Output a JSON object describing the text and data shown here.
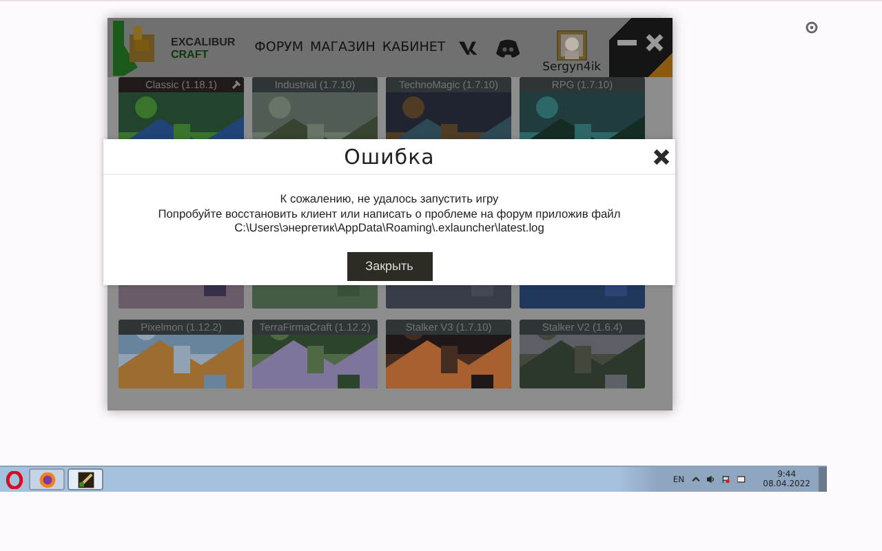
{
  "launcher": {
    "logo": {
      "line_1": "EXCALIBUR",
      "line_2": "CRAFT"
    },
    "nav": [
      {
        "label": "ФОРУМ"
      },
      {
        "label": "МАГАЗИН"
      },
      {
        "label": "КАБИНЕТ"
      }
    ],
    "user": {
      "name": "Sergyn4ik"
    },
    "servers": [
      {
        "kind": "card",
        "name": "Classic (1.18.1)",
        "selected": true
      },
      {
        "kind": "card",
        "name": "Industrial (1.7.10)",
        "selected": false
      },
      {
        "kind": "card",
        "name": "TechnoMagic (1.7.10)",
        "selected": false
      },
      {
        "kind": "card",
        "name": "RPG (1.7.10)",
        "selected": false
      },
      {
        "kind": "picture"
      },
      {
        "kind": "picture"
      },
      {
        "kind": "picture"
      },
      {
        "kind": "picture"
      },
      {
        "kind": "card",
        "name": "Pixelmon (1.12.2)",
        "selected": false
      },
      {
        "kind": "card",
        "name": "TerraFirmaCraft (1.12.2)",
        "selected": false
      },
      {
        "kind": "card",
        "name": "Stalker V3 (1.7.10)",
        "selected": false
      },
      {
        "kind": "card",
        "name": "Stalker V2 (1.6.4)",
        "selected": false
      }
    ]
  },
  "dialog": {
    "title": "Ошибка",
    "message": [
      "К сожалению, не удалось запустить игру",
      "Попробуйте восстановить клиент или написать о проблеме на форум приложив файл",
      "C:\\Users\\энергетик\\AppData\\Roaming\\.exlauncher\\latest.log"
    ],
    "button": "Закрыть"
  },
  "taskbar": {
    "apps": [
      {
        "kind": "opera"
      },
      {
        "kind": "firefox",
        "active": false
      },
      {
        "kind": "launcher",
        "active": true
      }
    ],
    "language": "EN",
    "time": "9:44",
    "date": "08.04.2022"
  }
}
